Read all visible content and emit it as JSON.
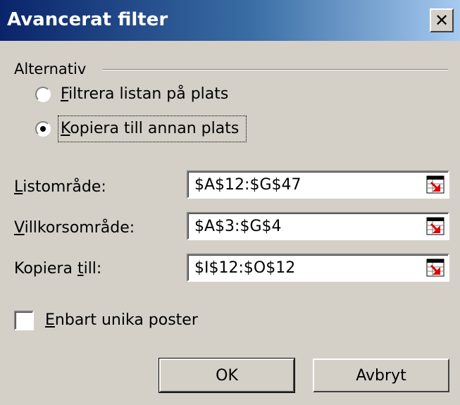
{
  "window": {
    "title": "Avancerat filter",
    "close_glyph": "✕"
  },
  "alternatives": {
    "group_label": "Alternativ",
    "options": [
      {
        "mnemonic": "F",
        "rest": "iltrera listan på plats",
        "selected": false
      },
      {
        "mnemonic": "K",
        "rest": "opiera till annan plats",
        "selected": true
      }
    ]
  },
  "fields": [
    {
      "label_pre": "",
      "mnemonic": "L",
      "label_post": "istområde:",
      "value": "$A$12:$G$47"
    },
    {
      "label_pre": "",
      "mnemonic": "V",
      "label_post": "illkorsområde:",
      "value": "$A$3:$G$4"
    },
    {
      "label_pre": "Kopiera ",
      "mnemonic": "t",
      "label_post": "ill:",
      "value": "$I$12:$O$12"
    }
  ],
  "unique": {
    "mnemonic": "E",
    "rest": "nbart unika poster",
    "checked": false
  },
  "buttons": {
    "ok": "OK",
    "cancel": "Avbryt"
  },
  "icons": {
    "close": "close-icon",
    "collapse": "collapse-dialog-icon"
  },
  "colors": {
    "face": "#d4d0c8",
    "title_start": "#0a246a",
    "title_end": "#a6caf0",
    "ref_arrow": "#e00000"
  }
}
